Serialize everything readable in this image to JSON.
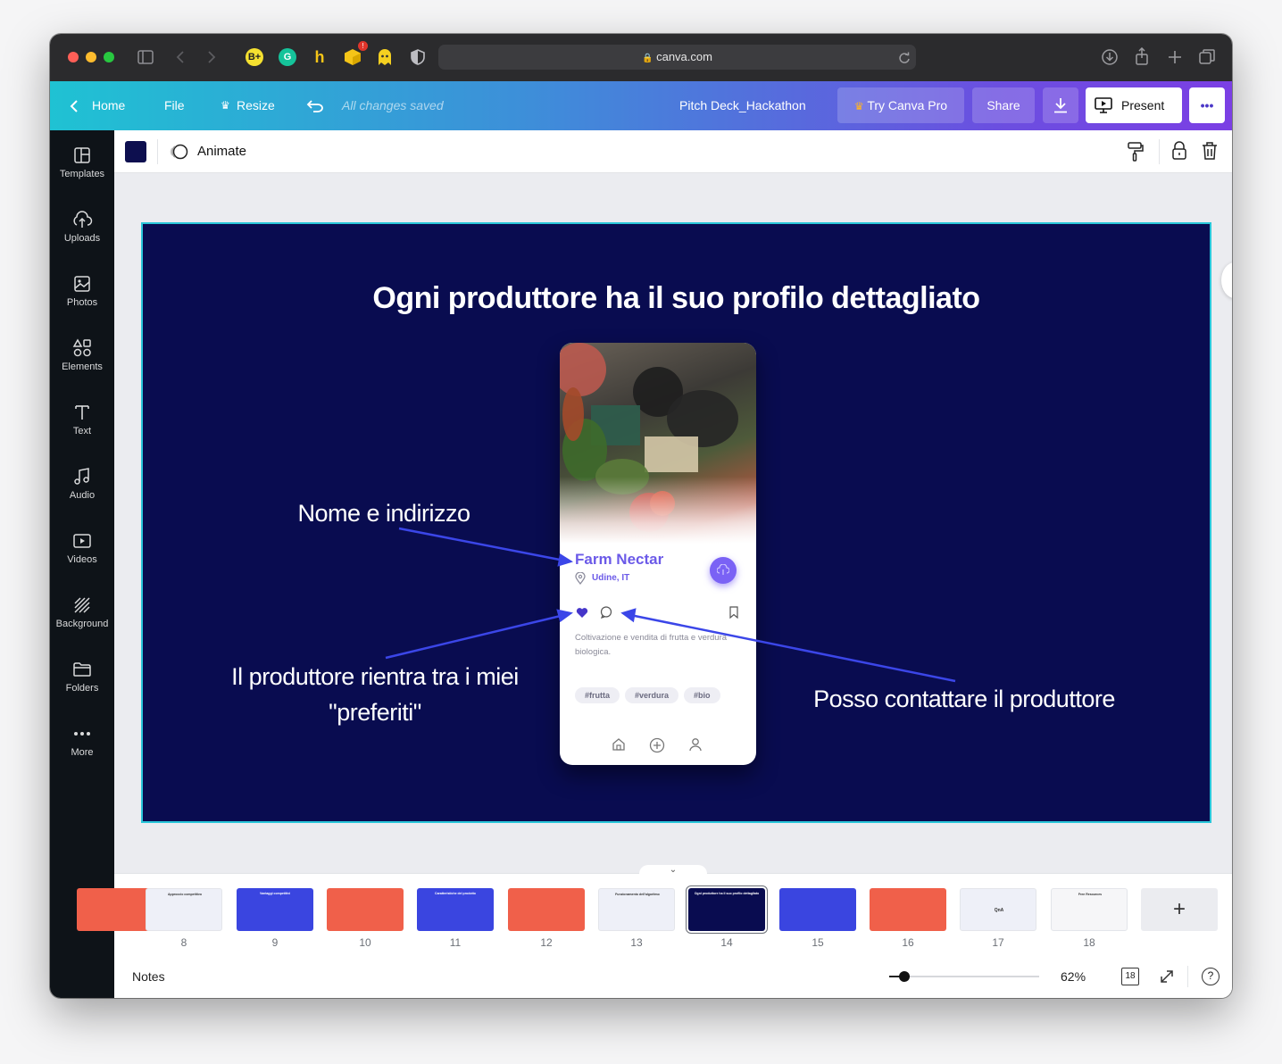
{
  "browser": {
    "url": "canva.com",
    "extensions": [
      "B+",
      "G",
      "h",
      "cube",
      "ghost",
      "shield"
    ]
  },
  "header": {
    "home": "Home",
    "file": "File",
    "resize": "Resize",
    "save_status": "All changes saved",
    "doc_title": "Pitch Deck_Hackathon",
    "try_pro": "Try Canva Pro",
    "share": "Share",
    "present": "Present",
    "more": "•••"
  },
  "sidebar": {
    "items": [
      {
        "label": "Templates",
        "icon": "templates-icon"
      },
      {
        "label": "Uploads",
        "icon": "upload-cloud-icon"
      },
      {
        "label": "Photos",
        "icon": "photo-icon"
      },
      {
        "label": "Elements",
        "icon": "shapes-icon"
      },
      {
        "label": "Text",
        "icon": "text-icon"
      },
      {
        "label": "Audio",
        "icon": "music-note-icon"
      },
      {
        "label": "Videos",
        "icon": "video-icon"
      },
      {
        "label": "Background",
        "icon": "hatch-icon"
      },
      {
        "label": "Folders",
        "icon": "folder-icon"
      },
      {
        "label": "More",
        "icon": "more-dots-icon"
      }
    ]
  },
  "toolbar": {
    "color": "#0d0f4f",
    "animate": "Animate"
  },
  "slide": {
    "title": "Ogni produttore ha il suo profilo dettagliato",
    "ann_name": "Nome e indirizzo",
    "ann_fav_line1": "Il produttore rientra tra i miei",
    "ann_fav_line2": "\"preferiti\"",
    "ann_contact": "Posso contattare il produttore",
    "phone": {
      "name": "Farm Nectar",
      "location": "Udine, IT",
      "description": "Coltivazione e vendita di frutta e verdura biologica.",
      "tags": [
        "#frutta",
        "#verdura",
        "#bio"
      ]
    }
  },
  "thumbnails": [
    {
      "num": "",
      "color": "#f0604a"
    },
    {
      "num": "8",
      "color": "#eef0f8"
    },
    {
      "num": "9",
      "color": "#3a45e0"
    },
    {
      "num": "10",
      "color": "#f0604a"
    },
    {
      "num": "11",
      "color": "#3a45e0"
    },
    {
      "num": "12",
      "color": "#f0604a"
    },
    {
      "num": "13",
      "color": "#eef0f8"
    },
    {
      "num": "14",
      "color": "#090c50"
    },
    {
      "num": "15",
      "color": "#3a45e0"
    },
    {
      "num": "16",
      "color": "#f0604a"
    },
    {
      "num": "17",
      "color": "#eef0f8"
    },
    {
      "num": "18",
      "color": "#f6f6f8"
    }
  ],
  "thumb_texts": {
    "t8": "Approccio competitivo",
    "t9": "Vantaggi competitivi",
    "t11": "Caratteristiche del prodotto",
    "t13": "Funzionamento dell'algoritmo",
    "t14": "Ogni produttore ha il suo profilo dettagliato",
    "t17": "QnA",
    "t18": "Free Resources"
  },
  "bottom": {
    "notes": "Notes",
    "zoom": "62%",
    "pages": "18",
    "help": "?"
  }
}
